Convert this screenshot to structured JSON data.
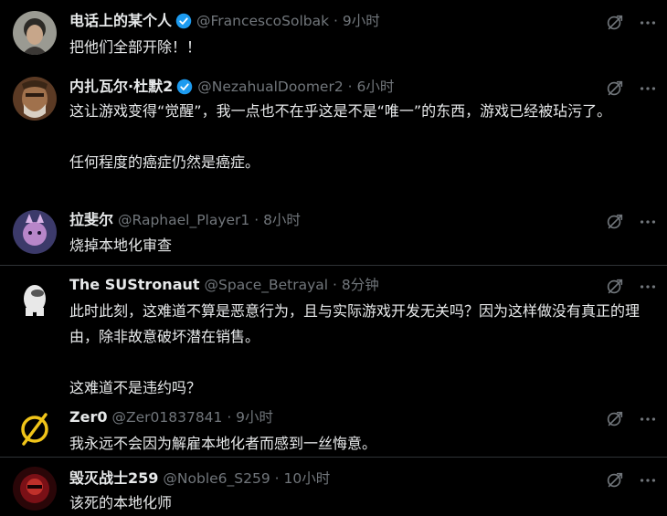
{
  "colors": {
    "background": "#000000",
    "text_primary": "#e7e9ea",
    "text_secondary": "#71767b",
    "divider": "#2f3336",
    "verified": "#1d9bf0"
  },
  "icons": {
    "grok": "grok-icon",
    "more": "more-icon",
    "verified": "verified-badge-icon"
  },
  "tweets": [
    {
      "name": "电话上的某个人",
      "verified": true,
      "meta": "@FrancescoSolbak · 9小时",
      "lines": [
        "把他们全部开除！！"
      ]
    },
    {
      "name": "内扎瓦尔·杜默2",
      "verified": true,
      "meta": "@NezahualDoomer2 · 6小时",
      "lines": [
        "这让游戏变得“觉醒”，我一点也不在乎这是不是“唯一”的东西，游戏已经被玷污了。",
        "任何程度的癌症仍然是癌症。"
      ]
    },
    {
      "name": "拉斐尔",
      "verified": false,
      "meta": "@Raphael_Player1 · 8小时",
      "lines": [
        "烧掉本地化审查"
      ]
    },
    {
      "name": "The SUStronaut",
      "verified": false,
      "meta": "@Space_Betrayal · 8分钟",
      "lines": [
        "此时此刻，这难道不算是恶意行为，且与实际游戏开发无关吗？因为这样做没有真正的理由，除非故意破坏潜在销售。",
        "这难道不是违约吗？"
      ]
    },
    {
      "name": "Zer0",
      "verified": false,
      "meta": "@Zer01837841 · 9小时",
      "lines": [
        "我永远不会因为解雇本地化者而感到一丝悔意。"
      ]
    },
    {
      "name": "毁灭战士259",
      "verified": false,
      "meta": "@Noble6_S259 · 10小时",
      "lines": [
        "该死的本地化师"
      ]
    }
  ]
}
